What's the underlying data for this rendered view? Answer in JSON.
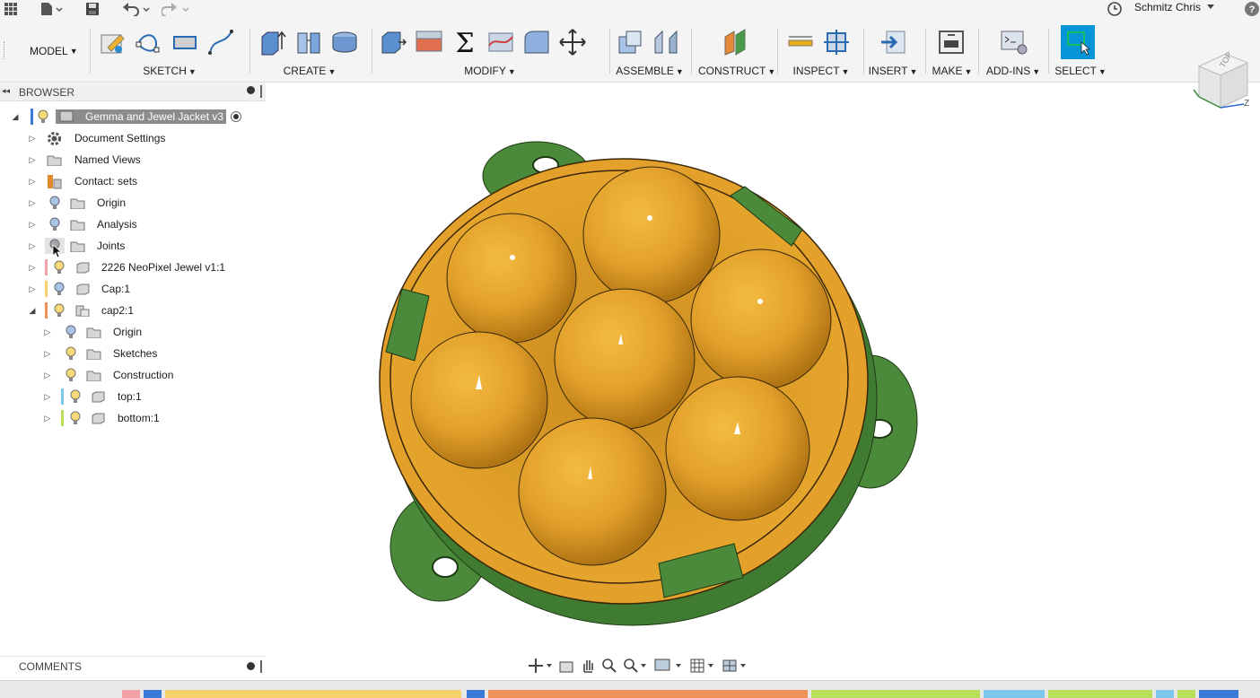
{
  "topbar": {
    "user_name": "Schmitz Chris",
    "icons": [
      "grid-icon",
      "file-icon",
      "save-icon",
      "undo-icon",
      "redo-icon",
      "clock-icon",
      "help-icon"
    ]
  },
  "toolbar": {
    "workspace": "MODEL",
    "groups": [
      {
        "name": "sketch",
        "label": "SKETCH"
      },
      {
        "name": "create",
        "label": "CREATE"
      },
      {
        "name": "modify",
        "label": "MODIFY"
      },
      {
        "name": "assemble",
        "label": "ASSEMBLE"
      },
      {
        "name": "construct",
        "label": "CONSTRUCT"
      },
      {
        "name": "inspect",
        "label": "INSPECT"
      },
      {
        "name": "insert",
        "label": "INSERT"
      },
      {
        "name": "make",
        "label": "MAKE"
      },
      {
        "name": "add-ins",
        "label": "ADD-INS"
      },
      {
        "name": "select",
        "label": "SELECT"
      }
    ]
  },
  "browser": {
    "title": "BROWSER",
    "items": [
      {
        "label": "Gemma and Jewel Jacket v3",
        "expanded": true
      },
      {
        "label": "Document Settings"
      },
      {
        "label": "Named Views"
      },
      {
        "label": "Contact: sets"
      },
      {
        "label": "Origin"
      },
      {
        "label": "Analysis"
      },
      {
        "label": "Joints"
      },
      {
        "label": "2226 NeoPixel Jewel v1:1"
      },
      {
        "label": "Cap:1"
      },
      {
        "label": "cap2:1",
        "expanded": true
      },
      {
        "label": "Origin"
      },
      {
        "label": "Sketches"
      },
      {
        "label": "Construction"
      },
      {
        "label": "top:1"
      },
      {
        "label": "bottom:1"
      }
    ]
  },
  "viewcube": {
    "face": "TOP",
    "axis_label": "Z"
  },
  "comments": {
    "title": "COMMENTS"
  },
  "colors": {
    "accent": "#0696d7",
    "model_orange": "#e3a02a",
    "model_green": "#4a8a3a",
    "toolbar_bg": "#f4f4f4"
  }
}
